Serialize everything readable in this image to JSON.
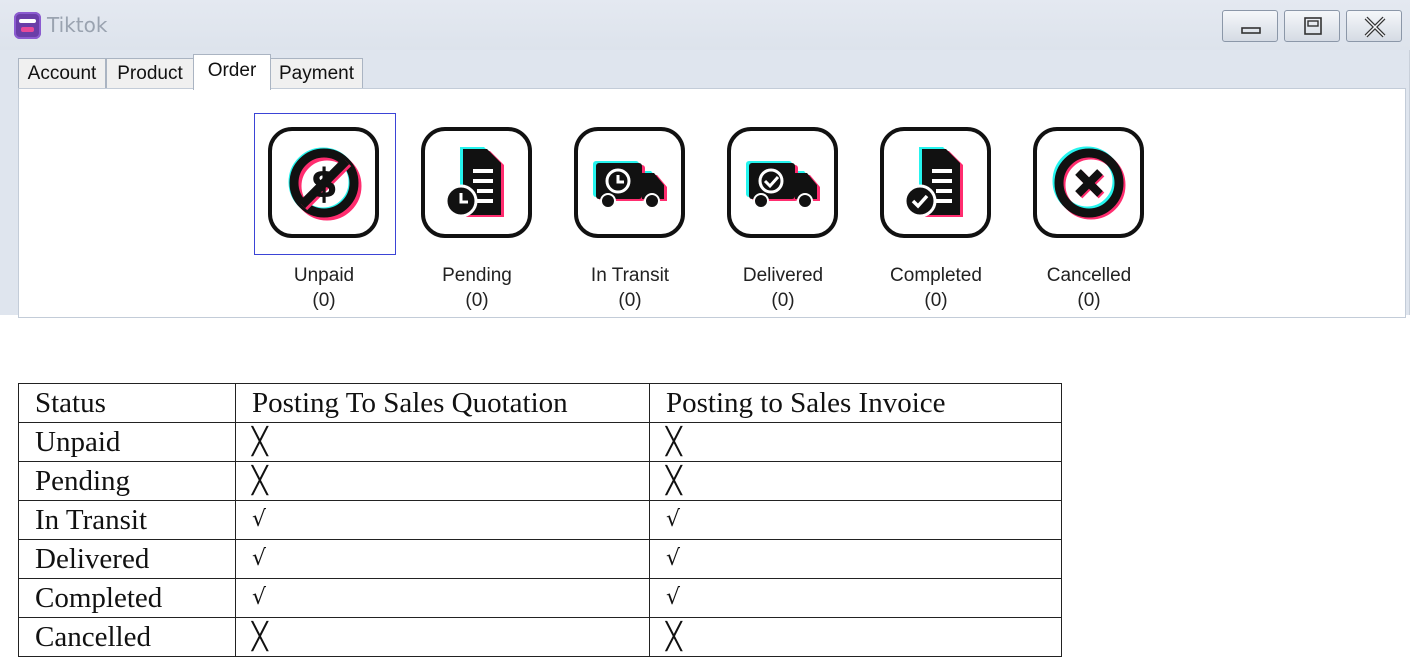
{
  "window": {
    "title": "Tiktok"
  },
  "tabs": [
    {
      "label": "Account",
      "active": false
    },
    {
      "label": "Product",
      "active": false
    },
    {
      "label": "Order",
      "active": true
    },
    {
      "label": "Payment",
      "active": false
    }
  ],
  "statuses": [
    {
      "label": "Unpaid",
      "count": "(0)",
      "icon": "no-dollar-icon",
      "selected": true
    },
    {
      "label": "Pending",
      "count": "(0)",
      "icon": "document-clock-icon",
      "selected": false
    },
    {
      "label": "In Transit",
      "count": "(0)",
      "icon": "truck-clock-icon",
      "selected": false
    },
    {
      "label": "Delivered",
      "count": "(0)",
      "icon": "truck-check-icon",
      "selected": false
    },
    {
      "label": "Completed",
      "count": "(0)",
      "icon": "document-check-icon",
      "selected": false
    },
    {
      "label": "Cancelled",
      "count": "(0)",
      "icon": "cancel-circle-icon",
      "selected": false
    }
  ],
  "table": {
    "headers": [
      "Status",
      "Posting To Sales Quotation",
      "Posting to Sales Invoice"
    ],
    "rows": [
      [
        "Unpaid",
        "╳",
        "╳"
      ],
      [
        "Pending",
        "╳",
        "╳"
      ],
      [
        "In Transit",
        "√",
        "√"
      ],
      [
        "Delivered",
        "√",
        "√"
      ],
      [
        "Completed",
        "√",
        "√"
      ],
      [
        "Cancelled",
        "╳",
        "╳"
      ]
    ]
  },
  "colors": {
    "selection_border": "#3b44d6",
    "icon_glow_pink": "#ff2d6f",
    "icon_glow_cyan": "#25f4ee"
  }
}
